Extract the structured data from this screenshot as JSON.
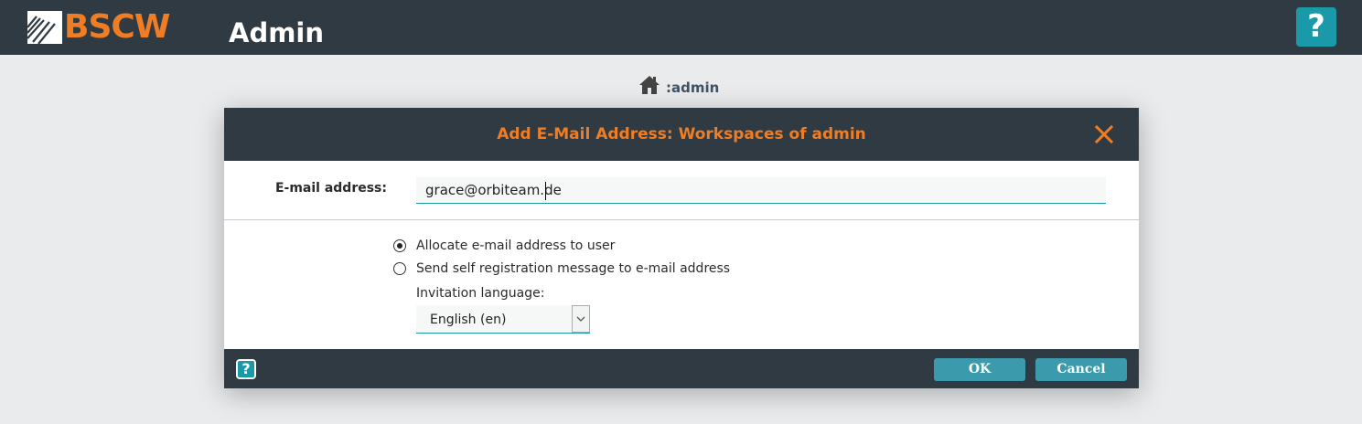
{
  "header": {
    "logo_text": "BSCW",
    "app_title": "Admin",
    "help_label": "?",
    "accent_color": "#f07d24",
    "bar_color": "#2f3a42"
  },
  "breadcrumb": {
    "icon": "home-icon",
    "text": ":admin"
  },
  "dialog": {
    "title": "Add E-Mail Address: Workspaces of admin",
    "close_icon": "close-icon",
    "email_label": "E-mail address:",
    "email_value": "grace@orbiteam.de",
    "options": [
      {
        "label": "Allocate e-mail address to user",
        "selected": true
      },
      {
        "label": "Send self registration message to e-mail address",
        "selected": false
      }
    ],
    "invitation_label": "Invitation language:",
    "language_selected": "English (en)",
    "footer": {
      "help_label": "?",
      "ok_label": "OK",
      "cancel_label": "Cancel",
      "button_color": "#3b9bad"
    }
  }
}
